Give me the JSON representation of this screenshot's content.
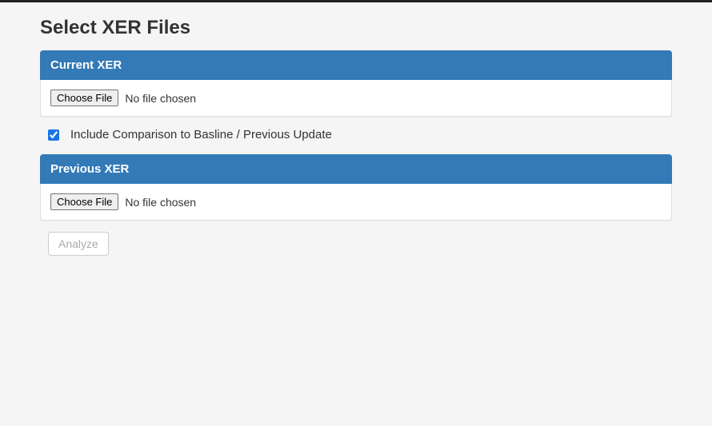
{
  "page": {
    "title": "Select XER Files"
  },
  "panels": {
    "current": {
      "heading": "Current XER",
      "choose_label": "Choose File",
      "status": "No file chosen"
    },
    "previous": {
      "heading": "Previous XER",
      "choose_label": "Choose File",
      "status": "No file chosen"
    }
  },
  "options": {
    "include_comparison_label": "Include Comparison to Basline / Previous Update",
    "include_comparison_checked": true
  },
  "actions": {
    "analyze_label": "Analyze"
  }
}
